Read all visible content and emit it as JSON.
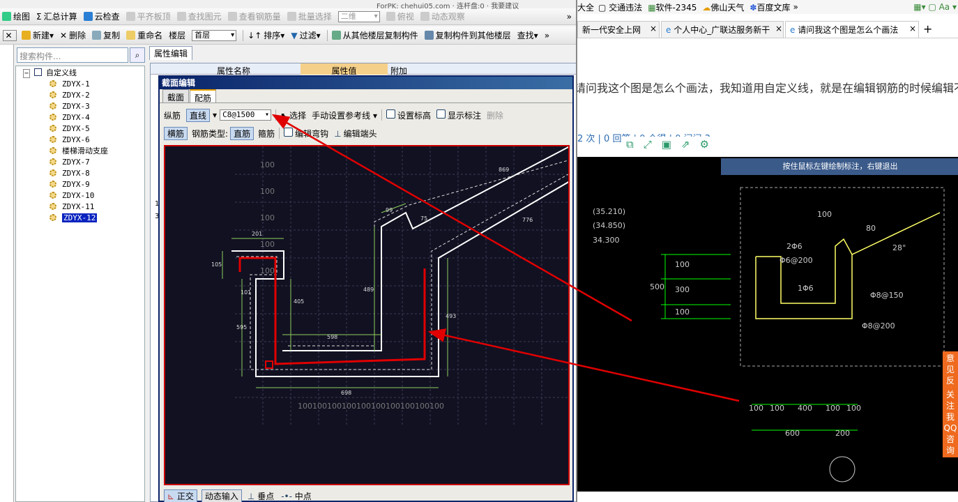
{
  "app": {
    "toolbar1": [
      "绘图",
      "汇总计算",
      "云检查",
      "平齐板顶",
      "查找图元",
      "查看钢筋量",
      "批量选择",
      "二维",
      "俯视",
      "动态观察"
    ],
    "toolbar1_overflow": "»",
    "topline": "ForPK: chehui05.com · 连杆盘:0 · 我要建议",
    "toolbar2": {
      "new": "新建",
      "delete": "删除",
      "copy": "复制",
      "rename": "重命名",
      "floor_label": "楼层",
      "floor_value": "首层",
      "sort": "排序",
      "filter": "过滤",
      "copy_from": "从其他楼层复制构件",
      "copy_to": "复制构件到其他楼层",
      "find": "查找"
    },
    "search_placeholder": "搜索构件...",
    "tree": {
      "root": "自定义线",
      "items": [
        "ZDYX-1",
        "ZDYX-2",
        "ZDYX-3",
        "ZDYX-4",
        "ZDYX-5",
        "ZDYX-6",
        "楼梯滑动支座",
        "ZDYX-7",
        "ZDYX-8",
        "ZDYX-9",
        "ZDYX-10",
        "ZDYX-11",
        "ZDYX-12"
      ],
      "selected_index": 12
    },
    "grid": {
      "tab": "属性编辑",
      "col_name": "属性名称",
      "col_value": "属性值",
      "col_extra": "附加",
      "row_nums": [
        "1",
        "3"
      ]
    },
    "dialog": {
      "title": "截面编辑",
      "tabs": [
        "截面",
        "配筋"
      ],
      "active_tab": "配筋",
      "row1": {
        "label": "纵筋",
        "mode": "直线",
        "spec": "C8@1500",
        "select": "选择",
        "ref": "手动设置参考线",
        "set_elev": "设置标高",
        "show_label": "显示标注",
        "delete": "删除"
      },
      "row2": {
        "mode": "横筋",
        "type_label": "钢筋类型:",
        "type_value": "直筋",
        "stirrup": "箍筋",
        "edit_hook": "编辑弯钩",
        "edit_end": "编辑端头"
      },
      "canvas": {
        "grid_labels": [
          "100",
          "100",
          "100",
          "100",
          "100",
          "100",
          "100",
          "100",
          "100",
          "100"
        ],
        "dims": {
          "d201": "201",
          "d105": "105",
          "d101": "101",
          "d595": "595",
          "d405": "405",
          "d598": "598",
          "d489": "489",
          "d99": "99",
          "d75": "75",
          "d493": "493",
          "d698": "698",
          "d869": "869",
          "d776": "776"
        },
        "side_labels": [
          "100",
          "100",
          "100",
          "100",
          "100"
        ]
      },
      "bottom": [
        "正交",
        "动态输入",
        "垂点",
        "中点"
      ]
    }
  },
  "browser": {
    "bookmarks": [
      "大全",
      "交通违法",
      "软件-2345",
      "佛山天气",
      "百度文库"
    ],
    "tabs": [
      "新一代安全上网",
      "个人中心_广联达服务新干",
      "请问我这个图是怎么个画法"
    ],
    "question": "请问我这个图是怎么个画法，我知道用自定义线，就是在编辑钢筋的时候编辑不到正确的位置",
    "stats": "2 次 | 0 回答 | 0 个得 | 0 问问 3",
    "cad": {
      "banner": "按住鼠标左键绘制标注，右键退出",
      "elev": [
        "(35.210)",
        "(34.850)",
        "34.300"
      ],
      "dims_v": [
        "100",
        "300",
        "100",
        "500"
      ],
      "rebar": [
        "2Φ6",
        "Φ6@200",
        "1Φ6",
        "Φ8@150",
        "Φ8@200"
      ],
      "slope": [
        "100",
        "80",
        "28°"
      ],
      "dims_h": [
        "100",
        "100",
        "400",
        "100",
        "100",
        "600",
        "200"
      ]
    },
    "side": [
      "意见反馈",
      "关注我们",
      "QQ咨询"
    ]
  },
  "colors": {
    "canvas_bg": "#111122",
    "rebar_red": "#e00000",
    "arrow_red": "#e00000",
    "cad_bg": "#000000",
    "cad_banner": "#3a5a8a"
  }
}
